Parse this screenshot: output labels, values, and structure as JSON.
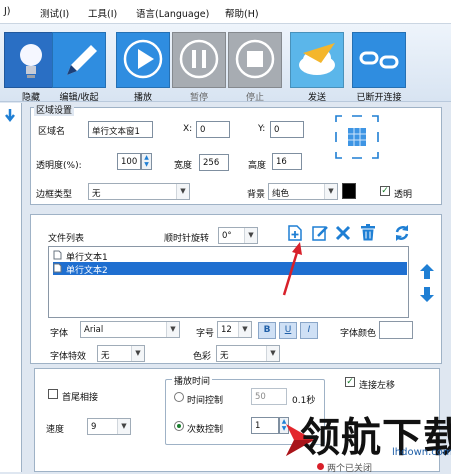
{
  "menu": {
    "item0": "J)",
    "test": "测试(I)",
    "tools": "工具(I)",
    "language": "语言(Language)",
    "help": "帮助(H)"
  },
  "toolbar": {
    "hide": "隐藏",
    "edit": "编辑/收起",
    "play": "播放",
    "pause": "暂停",
    "stop": "停止",
    "send": "发送",
    "disconnected": "已断开连接"
  },
  "region": {
    "section_title": "区域设置",
    "name_label": "区域名",
    "name_value": "单行文本窗1",
    "x_label": "X:",
    "x_value": "0",
    "y_label": "Y:",
    "y_value": "0",
    "opacity_label": "透明度(%):",
    "opacity_value": "100",
    "width_label": "宽度",
    "width_value": "256",
    "height_label": "高度",
    "height_value": "16",
    "border_label": "边框类型",
    "border_value": "无",
    "background_label": "背景",
    "background_value": "纯色",
    "transparent_label": "透明"
  },
  "files": {
    "list_label": "文件列表",
    "rotate_label": "顺时针旋转",
    "rotate_value": "0°",
    "items": [
      "单行文本1",
      "单行文本2"
    ],
    "font_label": "字体",
    "font_value": "Arial",
    "size_label": "字号",
    "size_value": "12",
    "bold": "B",
    "underline": "U",
    "italic": "I",
    "color_label": "字体颜色",
    "effect_label": "字体特效",
    "effect_value": "无",
    "colorful_label": "色彩",
    "colorful_value": "无"
  },
  "playback": {
    "loop_label": "首尾相接",
    "speed_label": "速度",
    "speed_value": "9",
    "group_title": "播放时间",
    "time_label": "时间控制",
    "time_value": "50",
    "time_unit": "0.1秒",
    "count_label": "次数控制",
    "count_value": "1",
    "scroll_left_label": "连接左移",
    "status": "两个已关闭"
  },
  "watermark": {
    "text": "领航下载",
    "url": "lhdown.com"
  },
  "colors": {
    "accent": "#1f7fd4",
    "selection": "#1f6fd0"
  }
}
